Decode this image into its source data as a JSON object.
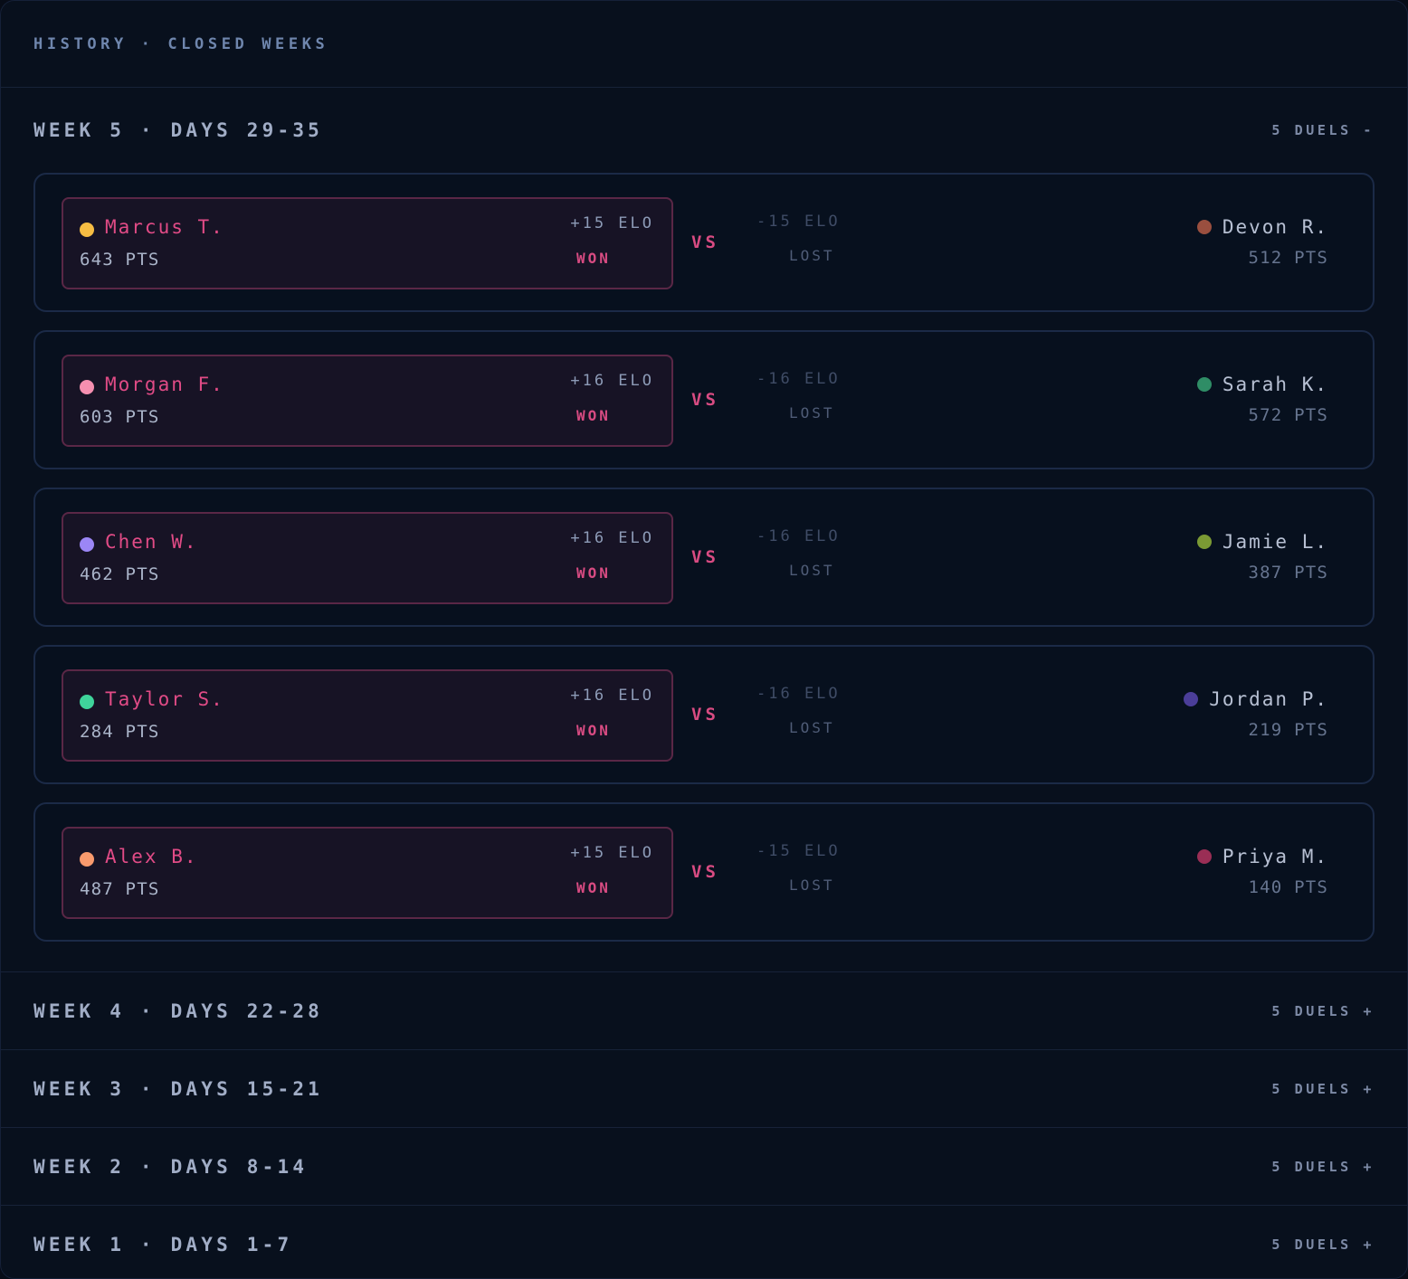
{
  "header": {
    "title": "HISTORY · CLOSED WEEKS"
  },
  "weeks": [
    {
      "label": "WEEK 5 · DAYS 29-35",
      "count": "5 DUELS -",
      "expanded": true,
      "duels": [
        {
          "winner": {
            "name": "Marcus T.",
            "pts": "643 PTS",
            "elo": "+15 ELO",
            "result": "WON",
            "color": "#f6bd43"
          },
          "vs": "VS",
          "loser": {
            "name": "Devon R.",
            "pts": "512 PTS",
            "elo": "-15 ELO",
            "result": "LOST",
            "color": "#9a4f3f"
          }
        },
        {
          "winner": {
            "name": "Morgan F.",
            "pts": "603 PTS",
            "elo": "+16 ELO",
            "result": "WON",
            "color": "#f58fb0"
          },
          "vs": "VS",
          "loser": {
            "name": "Sarah K.",
            "pts": "572 PTS",
            "elo": "-16 ELO",
            "result": "LOST",
            "color": "#2f8d66"
          }
        },
        {
          "winner": {
            "name": "Chen W.",
            "pts": "462 PTS",
            "elo": "+16 ELO",
            "result": "WON",
            "color": "#9b86f5"
          },
          "vs": "VS",
          "loser": {
            "name": "Jamie L.",
            "pts": "387 PTS",
            "elo": "-16 ELO",
            "result": "LOST",
            "color": "#7b9a34"
          }
        },
        {
          "winner": {
            "name": "Taylor S.",
            "pts": "284 PTS",
            "elo": "+16 ELO",
            "result": "WON",
            "color": "#3fd49b"
          },
          "vs": "VS",
          "loser": {
            "name": "Jordan P.",
            "pts": "219 PTS",
            "elo": "-16 ELO",
            "result": "LOST",
            "color": "#4b3e99"
          }
        },
        {
          "winner": {
            "name": "Alex B.",
            "pts": "487 PTS",
            "elo": "+15 ELO",
            "result": "WON",
            "color": "#f99a6d"
          },
          "vs": "VS",
          "loser": {
            "name": "Priya M.",
            "pts": "140 PTS",
            "elo": "-15 ELO",
            "result": "LOST",
            "color": "#9a2e55"
          }
        }
      ]
    },
    {
      "label": "WEEK 4 · DAYS 22-28",
      "count": "5 DUELS +",
      "expanded": false
    },
    {
      "label": "WEEK 3 · DAYS 15-21",
      "count": "5 DUELS +",
      "expanded": false
    },
    {
      "label": "WEEK 2 · DAYS 8-14",
      "count": "5 DUELS +",
      "expanded": false
    },
    {
      "label": "WEEK 1 · DAYS 1-7",
      "count": "5 DUELS +",
      "expanded": false
    }
  ]
}
